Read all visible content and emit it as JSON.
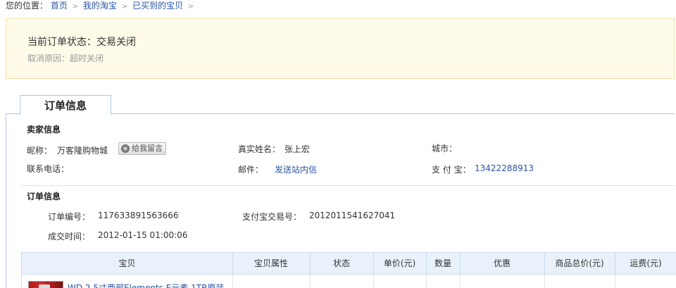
{
  "breadcrumb": {
    "prefix": "您的位置：",
    "items": [
      "首页",
      "我的淘宝",
      "已买到的宝贝"
    ],
    "separator": ">"
  },
  "status": {
    "label": "当前订单状态：",
    "value": "交易关闭",
    "reason_label": "取消原因：",
    "reason_value": "超时关闭"
  },
  "tab": {
    "label": "订单信息"
  },
  "seller": {
    "title": "卖家信息",
    "nickname_label": "昵称：",
    "nickname": "万客隆购物城",
    "message_button": "给我留言",
    "realname_label": "真实姓名：",
    "realname": "张上宏",
    "city_label": "城市：",
    "city": "",
    "phone_label": "联系电话：",
    "phone": "",
    "mail_label": "邮件：",
    "mail_link": "发送站内信",
    "alipay_label": "支 付 宝：",
    "alipay": "13422288913"
  },
  "order": {
    "title": "订单信息",
    "order_no_label": "订单编号：",
    "order_no": "117633891563666",
    "trade_no_label": "支付宝交易号：",
    "trade_no": "2012011541627041",
    "time_label": "成交时间：",
    "time": "2012-01-15 01:00:06"
  },
  "table": {
    "columns": [
      "宝贝",
      "宝贝属性",
      "状态",
      "单价(元)",
      "数量",
      "优惠",
      "商品总价(元)",
      "运费(元)"
    ],
    "first_item_title": "WD 2.5寸西部Elements E元素 1TB原装"
  }
}
